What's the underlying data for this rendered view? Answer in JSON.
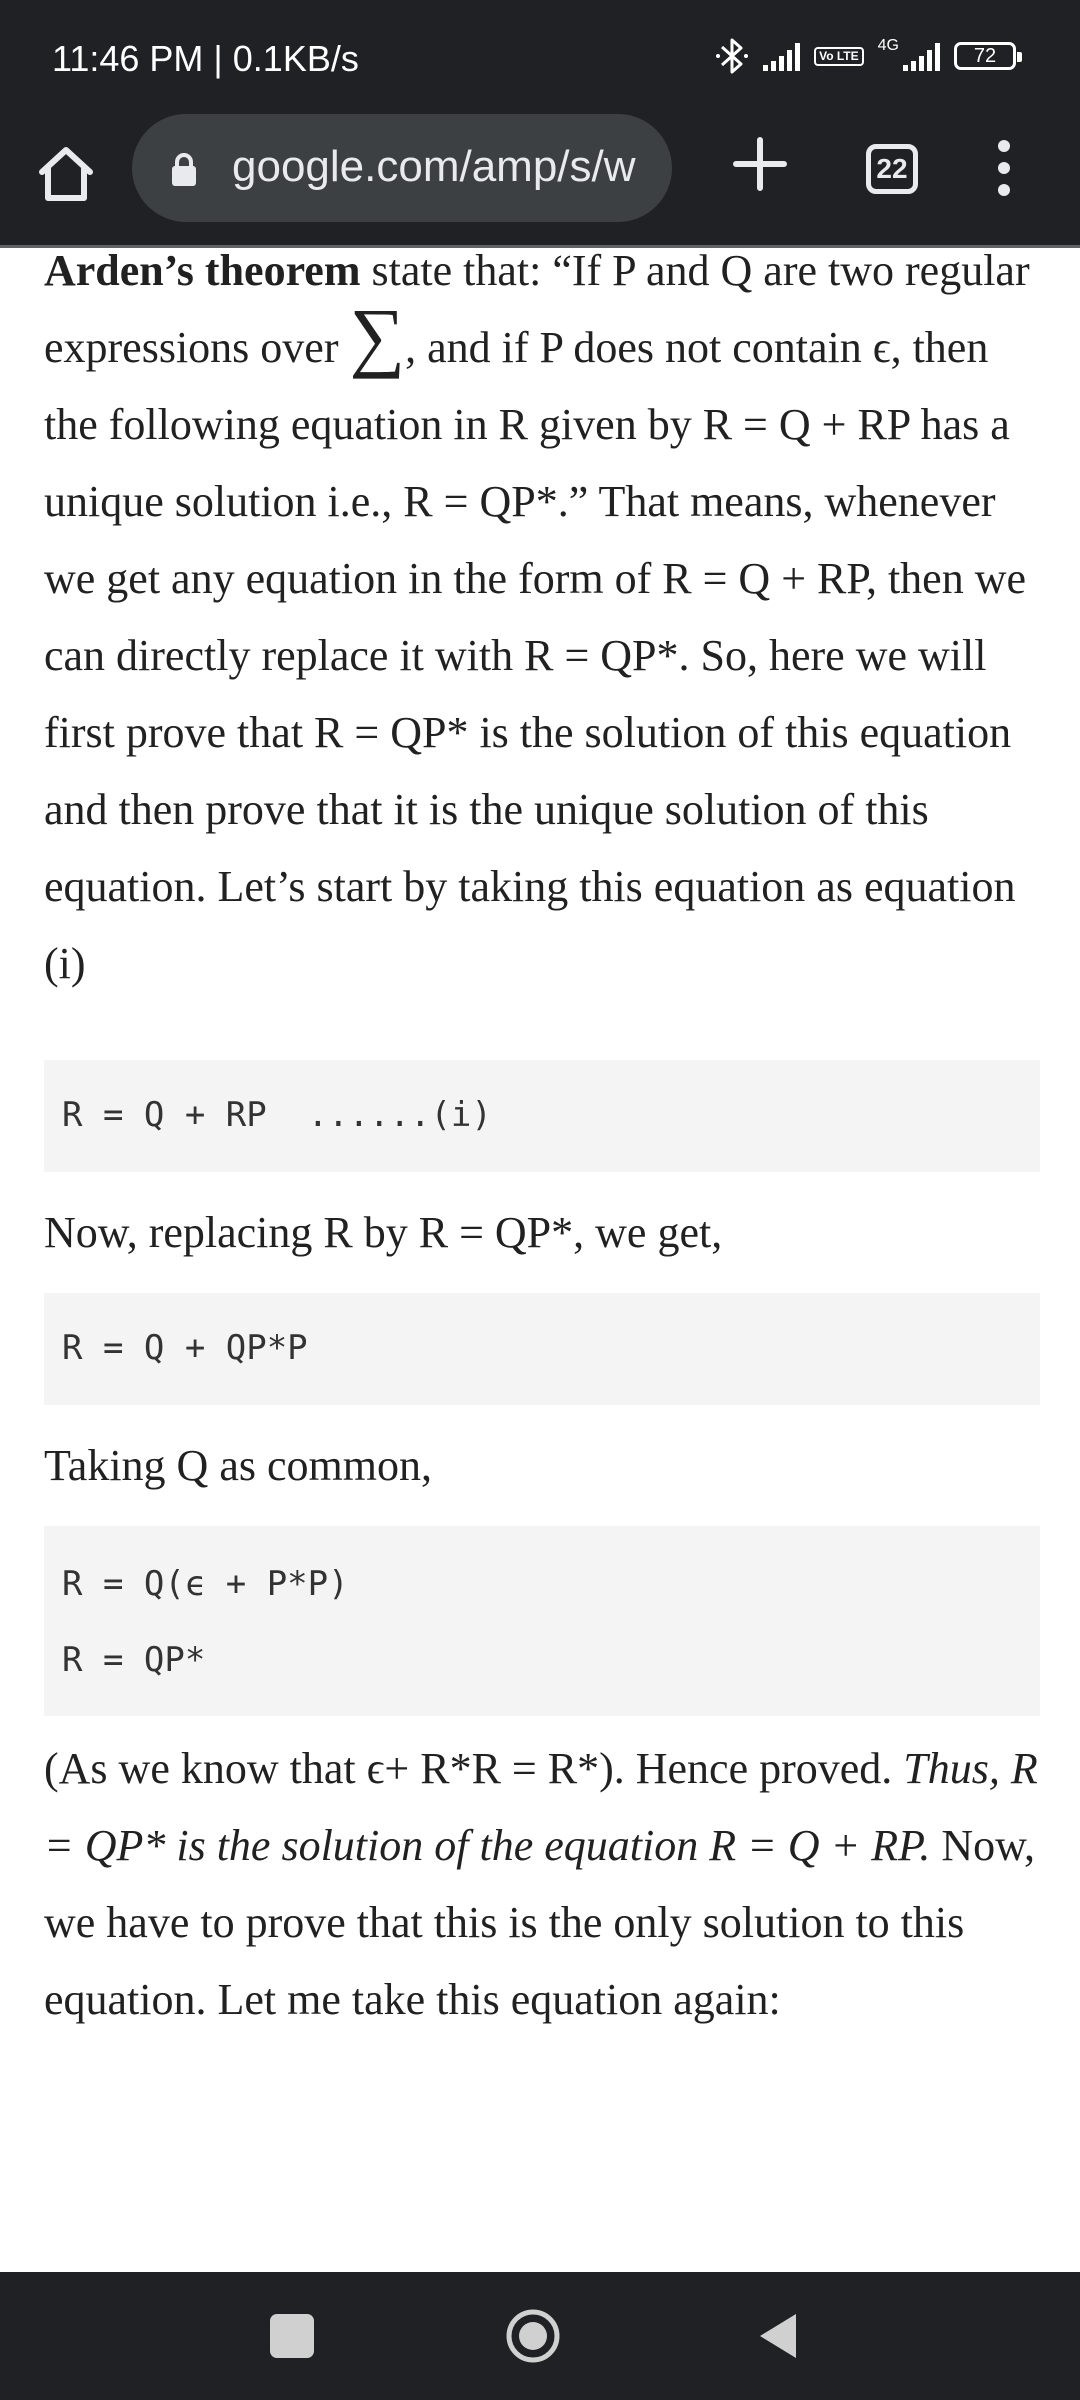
{
  "status_bar": {
    "time_speed": "11:46 PM | 0.1KB/s",
    "volte": "Vo LTE",
    "network": "4G",
    "battery": "72"
  },
  "toolbar": {
    "url": "google.com/amp/s/w",
    "tab_count": "22"
  },
  "article": {
    "intro": {
      "theorem_name": "Arden’s theorem",
      "t1": " state that: “If P and Q are two regular expressions over ",
      "sigma": "∑",
      "t2": ", and if P does not contain ",
      "epsilon": "ϵ",
      "t3": ", then the following equation in R given by R = Q + RP has a unique solution i.e., R = QP*.” That means, whenever we get any equation in the form of R = Q + RP, then we can directly replace it with R = QP*. So, here we will first prove that R = QP* is the solution of this equation and then prove that it is the unique solution of this equation. Let’s start by taking this equation as equation (i)"
    },
    "code1": "R = Q + RP  ......(i)",
    "para2": "Now, replacing R by R = QP*, we get,",
    "code2": "R = Q + QP*P",
    "para3": "Taking Q as common,",
    "code3": [
      "R = Q(ϵ + P*P)",
      "R = QP*"
    ],
    "para4": {
      "t1": "(As we know that ",
      "epsilon": "ϵ",
      "t2": "+ R*R = R*). Hence proved. ",
      "italic": "Thus, R = QP* is the solution of the equation R = Q + RP.",
      "t3": " Now, we have to prove that this is the only solution to this equation. Let me take this equation again:"
    }
  },
  "icons": {
    "home": "home-icon",
    "lock": "lock-icon",
    "new_tab": "plus-icon",
    "menu": "more-vert-icon",
    "nav_recent": "square-icon",
    "nav_home": "circle-icon",
    "nav_back": "triangle-back-icon"
  },
  "colors": {
    "chrome_dark": "#202124",
    "url_bar": "#3c4043",
    "code_bg": "#f4f4f4",
    "text": "#212121"
  }
}
